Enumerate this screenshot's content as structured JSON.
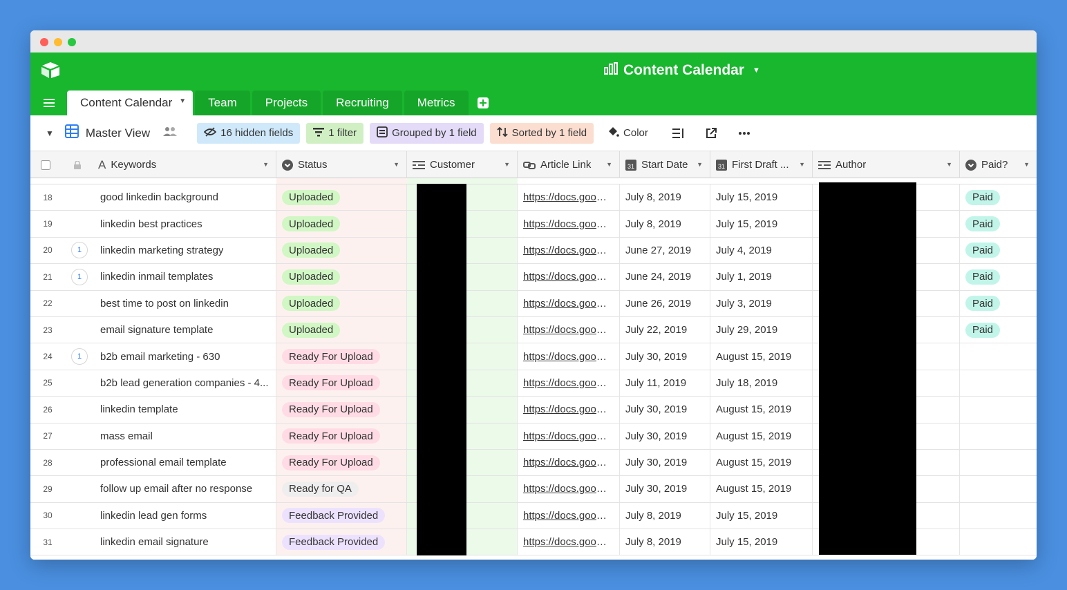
{
  "window": {
    "base_title": "Content Calendar"
  },
  "tabs": [
    {
      "label": "Content Calendar",
      "active": true
    },
    {
      "label": "Team"
    },
    {
      "label": "Projects"
    },
    {
      "label": "Recruiting"
    },
    {
      "label": "Metrics"
    }
  ],
  "toolbar": {
    "view_name": "Master View",
    "hidden_fields": "16 hidden fields",
    "filter": "1 filter",
    "grouped": "Grouped by 1 field",
    "sorted": "Sorted by 1 field",
    "color": "Color"
  },
  "columns": {
    "keywords": "Keywords",
    "status": "Status",
    "customer": "Customer",
    "article_link": "Article Link",
    "start_date": "Start Date",
    "first_draft": "First Draft ...",
    "author": "Author",
    "paid": "Paid?"
  },
  "status_colors": {
    "Uploaded": {
      "bg": "#d1f7c4",
      "fg": "#333333"
    },
    "Ready For Upload": {
      "bg": "#ffdce5",
      "fg": "#333333"
    },
    "Ready for QA": {
      "bg": "#eeeeee",
      "fg": "#333333"
    },
    "Feedback Provided": {
      "bg": "#ede2fe",
      "fg": "#333333"
    }
  },
  "paid_color": "#c2f5e9",
  "rows": [
    {
      "num": "18",
      "badge": "",
      "keyword": "good linkedin background",
      "status": "Uploaded",
      "link": "https://docs.google.com/document",
      "start": "July 8, 2019",
      "draft": "July 15, 2019",
      "paid": "Paid"
    },
    {
      "num": "19",
      "badge": "",
      "keyword": "linkedin best practices",
      "status": "Uploaded",
      "link": "https://docs.google.com/document",
      "start": "July 8, 2019",
      "draft": "July 15, 2019",
      "paid": "Paid"
    },
    {
      "num": "20",
      "badge": "1",
      "keyword": "linkedin marketing strategy",
      "status": "Uploaded",
      "link": "https://docs.google.com/document",
      "start": "June 27, 2019",
      "draft": "July 4, 2019",
      "paid": "Paid"
    },
    {
      "num": "21",
      "badge": "1",
      "keyword": "linkedin inmail templates",
      "status": "Uploaded",
      "link": "https://docs.google.com/document",
      "start": "June 24, 2019",
      "draft": "July 1, 2019",
      "paid": "Paid"
    },
    {
      "num": "22",
      "badge": "",
      "keyword": "best time to post on linkedin",
      "status": "Uploaded",
      "link": "https://docs.google.com/document",
      "start": "June 26, 2019",
      "draft": "July 3, 2019",
      "paid": "Paid"
    },
    {
      "num": "23",
      "badge": "",
      "keyword": "email signature template",
      "status": "Uploaded",
      "link": "https://docs.google.com/document",
      "start": "July 22, 2019",
      "draft": "July 29, 2019",
      "paid": "Paid"
    },
    {
      "num": "24",
      "badge": "1",
      "keyword": "b2b email marketing - 630",
      "status": "Ready For Upload",
      "link": "https://docs.google.com/document",
      "start": "July 30, 2019",
      "draft": "August 15, 2019",
      "paid": ""
    },
    {
      "num": "25",
      "badge": "",
      "keyword": "b2b lead generation companies - 4...",
      "status": "Ready For Upload",
      "link": "https://docs.google.com/document",
      "start": "July 11, 2019",
      "draft": "July 18, 2019",
      "paid": ""
    },
    {
      "num": "26",
      "badge": "",
      "keyword": "linkedin template",
      "status": "Ready For Upload",
      "link": "https://docs.google.com/document",
      "start": "July 30, 2019",
      "draft": "August 15, 2019",
      "paid": ""
    },
    {
      "num": "27",
      "badge": "",
      "keyword": "mass email",
      "status": "Ready For Upload",
      "link": "https://docs.google.com/document",
      "start": "July 30, 2019",
      "draft": "August 15, 2019",
      "paid": ""
    },
    {
      "num": "28",
      "badge": "",
      "keyword": "professional email template",
      "status": "Ready For Upload",
      "link": "https://docs.google.com/document",
      "start": "July 30, 2019",
      "draft": "August 15, 2019",
      "paid": ""
    },
    {
      "num": "29",
      "badge": "",
      "keyword": "follow up email after no response",
      "status": "Ready for QA",
      "link": "https://docs.google.com/document",
      "start": "July 30, 2019",
      "draft": "August 15, 2019",
      "paid": ""
    },
    {
      "num": "30",
      "badge": "",
      "keyword": "linkedin lead gen forms",
      "status": "Feedback Provided",
      "link": "https://docs.google.com/document",
      "start": "July 8, 2019",
      "draft": "July 15, 2019",
      "paid": ""
    },
    {
      "num": "31",
      "badge": "",
      "keyword": "linkedin email signature",
      "status": "Feedback Provided",
      "link": "https://docs.google.com/document",
      "start": "July 8, 2019",
      "draft": "July 15, 2019",
      "paid": ""
    }
  ]
}
